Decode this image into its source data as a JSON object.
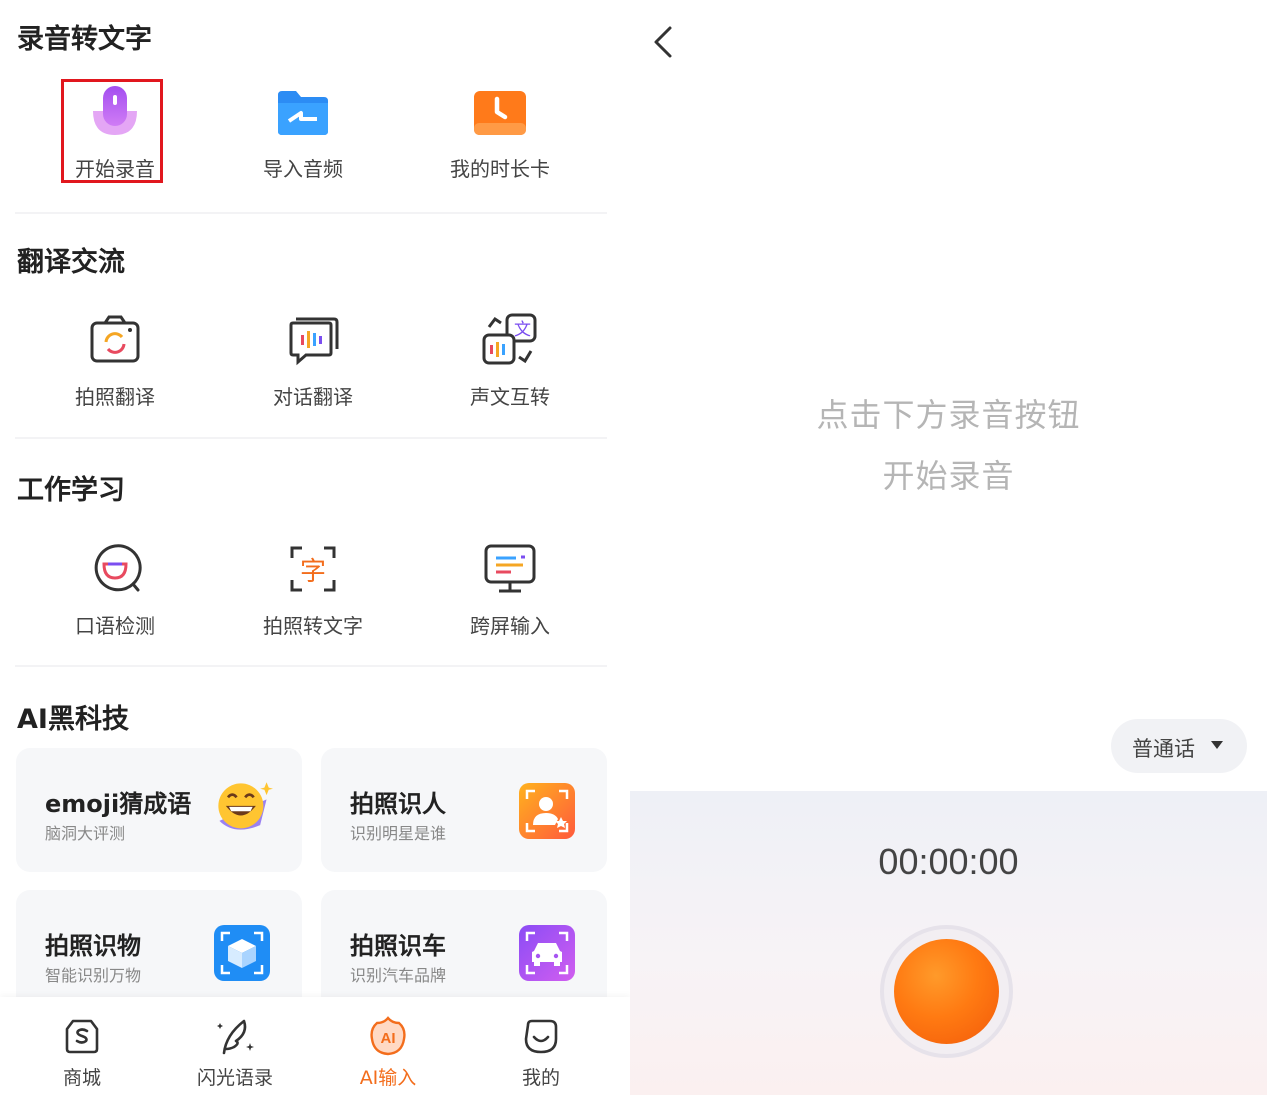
{
  "sections": {
    "recording": {
      "title": "录音转文字",
      "items": [
        "开始录音",
        "导入音频",
        "我的时长卡"
      ]
    },
    "translate": {
      "title": "翻译交流",
      "items": [
        "拍照翻译",
        "对话翻译",
        "声文互转"
      ]
    },
    "work": {
      "title": "工作学习",
      "items": [
        "口语检测",
        "拍照转文字",
        "跨屏输入"
      ]
    },
    "ai": {
      "title": "AI黑科技",
      "cards": [
        {
          "title": "emoji猜成语",
          "subtitle": "脑洞大评测"
        },
        {
          "title": "拍照识人",
          "subtitle": "识别明星是谁"
        },
        {
          "title": "拍照识物",
          "subtitle": "智能识别万物"
        },
        {
          "title": "拍照识车",
          "subtitle": "识别汽车品牌"
        }
      ]
    }
  },
  "tabs": [
    "商城",
    "闪光语录",
    "AI输入",
    "我的"
  ],
  "active_tab_color": "#f36d1c",
  "recorder": {
    "hint_line1": "点击下方录音按钮",
    "hint_line2": "开始录音",
    "language": "普通话",
    "timer": "00:00:00",
    "button_color": "#ff7a12"
  }
}
